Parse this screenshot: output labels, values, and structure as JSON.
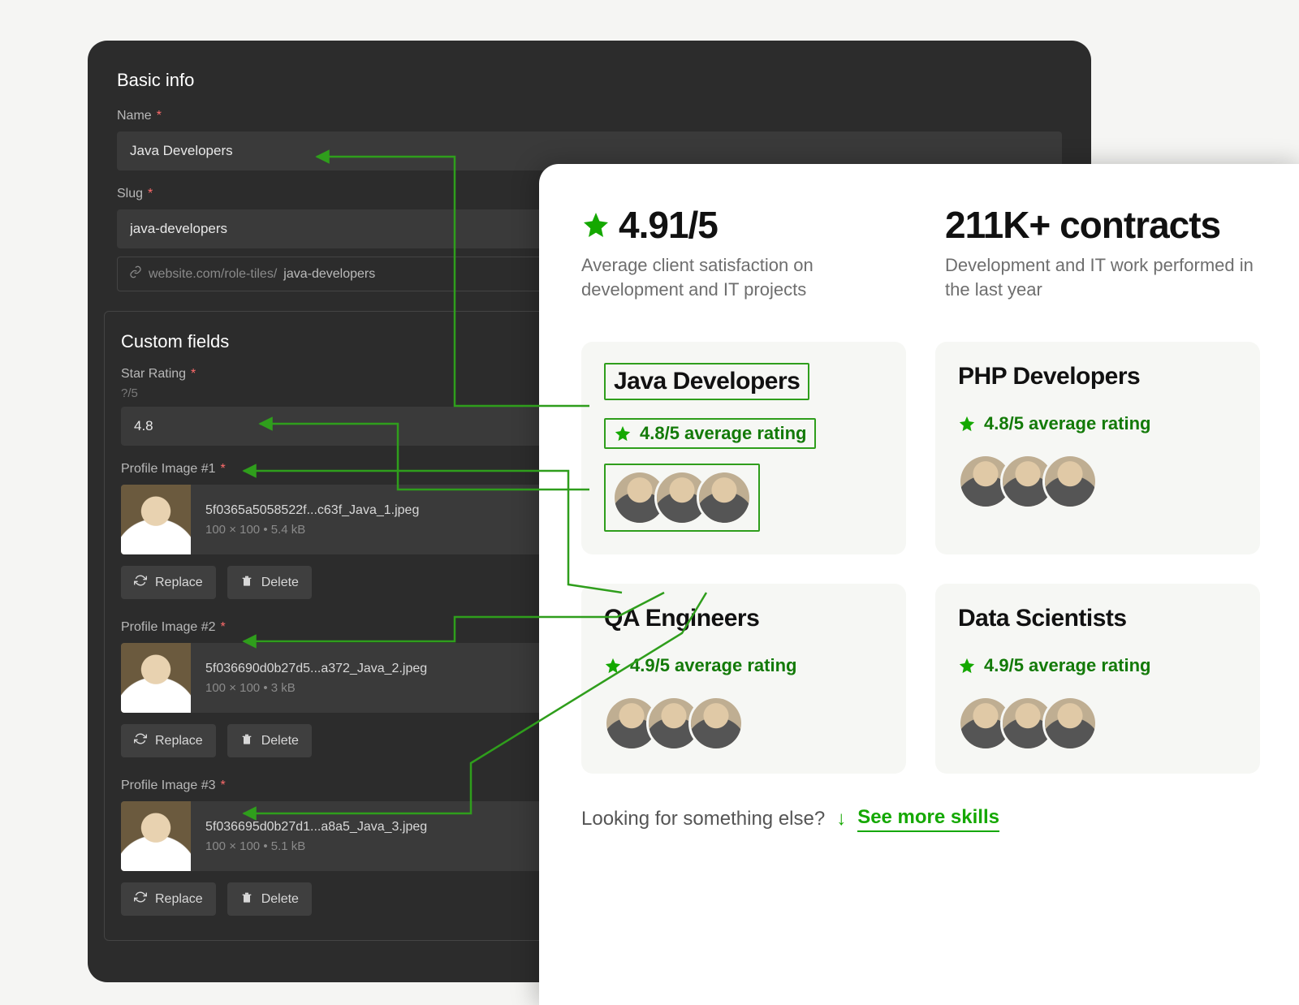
{
  "cms": {
    "section_title": "Basic info",
    "name_label": "Name",
    "name_value": "Java Developers",
    "slug_label": "Slug",
    "slug_value": "java-developers",
    "url_prefix": "website.com/role-tiles/",
    "url_slug": "java-developers",
    "custom_fields_title": "Custom fields",
    "star_rating_label": "Star Rating",
    "star_rating_hint": "?/5",
    "star_rating_value": "4.8",
    "replace_label": "Replace",
    "delete_label": "Delete",
    "images": [
      {
        "label": "Profile Image #1",
        "filename": "5f0365a5058522f...c63f_Java_1.jpeg",
        "dims": "100 × 100 • 5.4 kB"
      },
      {
        "label": "Profile Image #2",
        "filename": "5f036690d0b27d5...a372_Java_2.jpeg",
        "dims": "100 × 100 • 3 kB"
      },
      {
        "label": "Profile Image #3",
        "filename": "5f036695d0b27d1...a8a5_Java_3.jpeg",
        "dims": "100 × 100 • 5.1 kB"
      }
    ]
  },
  "result": {
    "rating_value": "4.91/5",
    "rating_caption": "Average client satisfaction on development and IT projects",
    "contracts_value": "211K+ contracts",
    "contracts_caption": "Development and IT work performed in the last year",
    "cards": [
      {
        "title": "Java Developers",
        "rating": "4.8/5 average rating"
      },
      {
        "title": "PHP Developers",
        "rating": "4.8/5 average rating"
      },
      {
        "title": "QA Engineers",
        "rating": "4.9/5 average rating"
      },
      {
        "title": "Data Scientists",
        "rating": "4.9/5 average rating"
      }
    ],
    "footer_prompt": "Looking for something else?",
    "footer_link": "See more skills"
  }
}
